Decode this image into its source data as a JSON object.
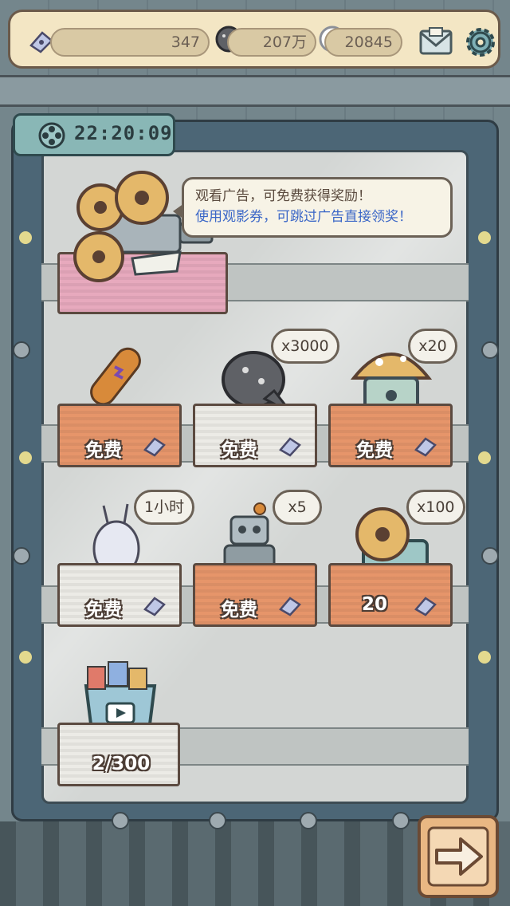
{
  "hud": {
    "tickets": "347",
    "gray_currency": "207万",
    "white_currency": "20845"
  },
  "timer": {
    "text": "22:20:09"
  },
  "bubble": {
    "line1": "观看广告，可免费获得奖励！",
    "line2": "使用观影券，可跳过广告直接领奖！"
  },
  "shelf_row1": [
    {
      "label": "免费",
      "badge": ""
    },
    {
      "label": "免费",
      "badge": "x3000"
    },
    {
      "label": "免费",
      "badge": "x20"
    }
  ],
  "shelf_row2": [
    {
      "label": "免费",
      "badge": "1小时"
    },
    {
      "label": "免费",
      "badge": "x5"
    },
    {
      "label": "20",
      "badge": "x100"
    }
  ],
  "shelf_row3": [
    {
      "label": "2/300"
    }
  ],
  "colors": {
    "frame": "#4c6676",
    "topbar": "#f3e6c4",
    "orange_cloth": "#e6956a",
    "white_cloth": "#ecebe6",
    "pink_cloth": "#e7a9bd",
    "link_blue": "#3a66c7"
  },
  "icons": [
    "ticket-icon",
    "gray-bubble-icon",
    "ghost-icon",
    "mail-icon",
    "gear-icon",
    "film-reel-icon",
    "arrow-right-icon"
  ]
}
